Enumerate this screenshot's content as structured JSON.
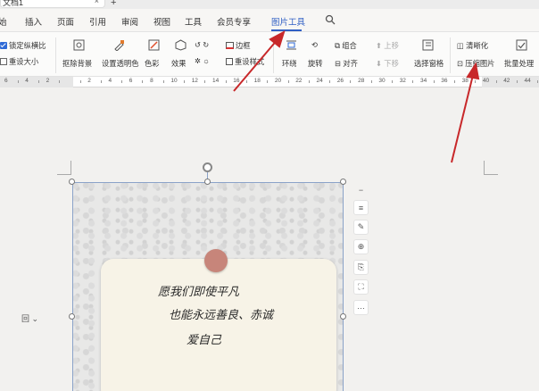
{
  "doc_tab": {
    "title": "文档1",
    "close": "×",
    "new": "+"
  },
  "menu": {
    "items": [
      "始",
      "插入",
      "页面",
      "引用",
      "审阅",
      "视图",
      "工具",
      "会员专享",
      "图片工具"
    ],
    "active": "图片工具"
  },
  "ribbon": {
    "lock_ratio": "锁定纵横比",
    "reset_size": "重设大小",
    "remove_bg": "抠除背景",
    "set_transparent": "设置透明色",
    "color": "色彩",
    "effects": "效果",
    "border": "边框",
    "reset_style": "重设样式",
    "wrap": "环绕",
    "rotate": "旋转",
    "align": "对齐",
    "group": "组合",
    "bring_forward": "上移",
    "send_backward": "下移",
    "selection_pane": "选择窗格",
    "sharpen": "清晰化",
    "compress": "压缩图片",
    "batch": "批量处理"
  },
  "ruler": {
    "labels": [
      "6",
      "4",
      "2",
      "",
      "2",
      "4",
      "6",
      "8",
      "10",
      "12",
      "14",
      "16",
      "18",
      "20",
      "22",
      "24",
      "26",
      "28",
      "30",
      "32",
      "34",
      "36",
      "38",
      "40",
      "42",
      "44"
    ]
  },
  "note_text": {
    "line1": "愿我们即使平凡",
    "line2": "也能永远善良、赤诚",
    "line3": "爱自己"
  },
  "float_tools": [
    "−",
    "≡",
    "✎",
    "⊕",
    "⎘",
    "⛶",
    "···"
  ],
  "wrap_indicator": "回 ⌄",
  "colors": {
    "accent": "#2f5fc4",
    "arrow": "#c8282a",
    "pin": "#c7857a"
  }
}
